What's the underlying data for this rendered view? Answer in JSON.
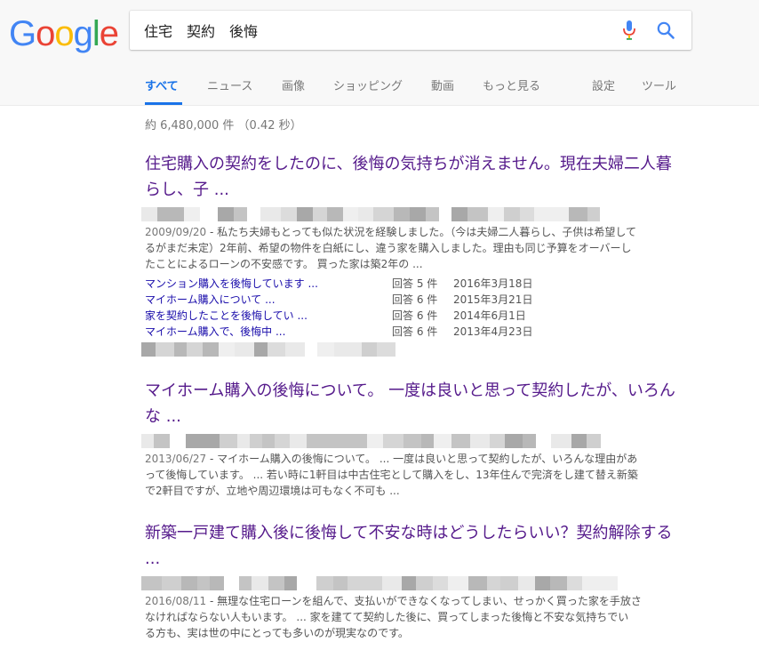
{
  "logo": {
    "letters": [
      "G",
      "o",
      "o",
      "g",
      "l",
      "e"
    ],
    "colors": [
      "#4285F4",
      "#EA4335",
      "#FBBC05",
      "#4285F4",
      "#34A853",
      "#EA4335"
    ]
  },
  "search": {
    "query": "住宅　契約　後悔"
  },
  "tabs": [
    {
      "label": "すべて",
      "active": true
    },
    {
      "label": "ニュース"
    },
    {
      "label": "画像"
    },
    {
      "label": "ショッピング"
    },
    {
      "label": "動画"
    },
    {
      "label": "もっと見る"
    },
    {
      "label": "設定"
    },
    {
      "label": "ツール"
    }
  ],
  "stats": "約 6,480,000 件 （0.42 秒）",
  "results": [
    {
      "title_line1": "住宅購入の契約をしたのに、後悔の気持ちが消えません。現在夫婦二人暮",
      "title_line2": "らし、子 ...",
      "date": "2009/09/20",
      "snippet_line1": " - 私たち夫婦もとっても似た状況を経験しました。（今は夫婦二人暮らし、子供は希望して",
      "snippet_line2": "るがまだ未定）2年前、希望の物件を白紙にし、違う家を購入しました。理由も同じ予算をオーバーし",
      "snippet_line3": "たことによるローンの不安感です。 買った家は築2年の ...",
      "sublinks": [
        {
          "text": "マンション購入を後悔しています ...",
          "count": "回答 5 件",
          "date": "2016年3月18日"
        },
        {
          "text": "マイホーム購入について ...",
          "count": "回答 6 件",
          "date": "2015年3月21日"
        },
        {
          "text": "家を契約したことを後悔してい ...",
          "count": "回答 6 件",
          "date": "2014年6月1日"
        },
        {
          "text": "マイホーム購入で、後悔中 ...",
          "count": "回答 6 件",
          "date": "2013年4月23日"
        }
      ]
    },
    {
      "title_line1": "マイホーム購入の後悔について。 一度は良いと思って契約したが、いろん",
      "title_line2": "な ...",
      "date": "2013/06/27",
      "snippet_line1": " - マイホーム購入の後悔について。 ... 一度は良いと思って契約したが、いろんな理由があ",
      "snippet_line2": "って後悔しています。 ... 若い時に1軒目は中古住宅として購入をし、13年住んで完済をし建て替え新築",
      "snippet_line3": "で2軒目ですが、立地や周辺環境は可もなく不可も ..."
    },
    {
      "title_line1": "新築一戸建て購入後に後悔して不安な時はどうしたらいい？契約解除する",
      "title_line2": "...",
      "date": "2016/08/11",
      "snippet_line1": " - 無理な住宅ローンを組んで、支払いができなくなってしまい、せっかく買った家を手放さ",
      "snippet_line2": "なければならない人もいます。 ... 家を建てて契約した後に、買ってしまった後悔と不安な気持ちでい",
      "snippet_line3": "る方も、実は世の中にとっても多いのが現実なのです。"
    }
  ]
}
